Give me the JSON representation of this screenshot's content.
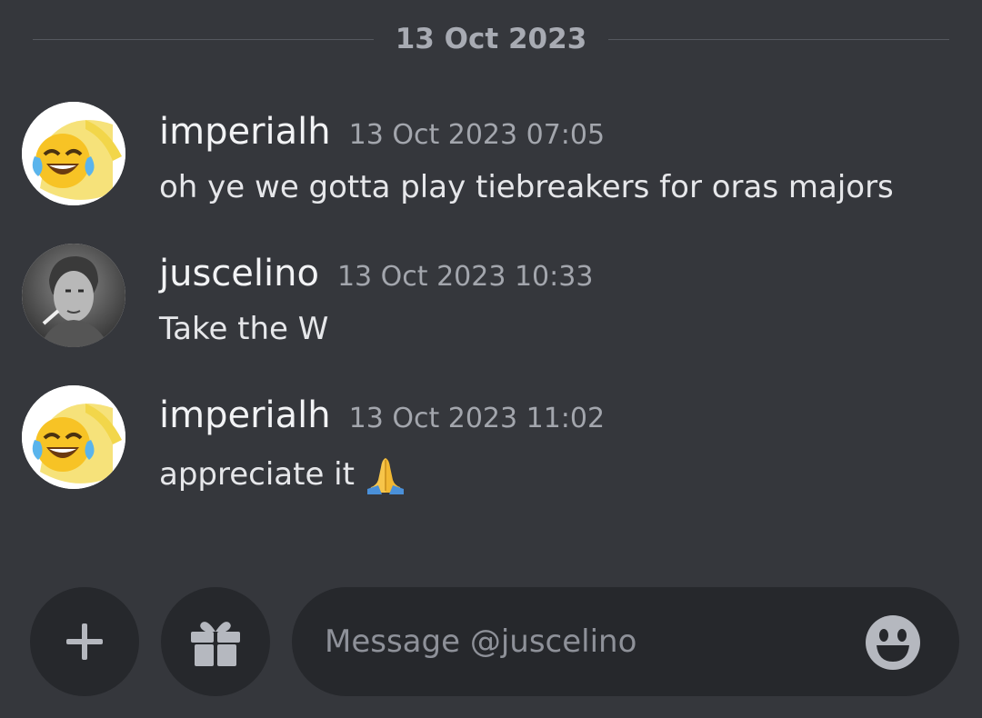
{
  "divider": {
    "date": "13 Oct 2023"
  },
  "messages": [
    {
      "username": "imperialh",
      "timestamp": "13 Oct 2023 07:05",
      "text": "oh ye we gotta play tiebreakers for oras majors",
      "avatar": "laughing-pikachu-avatar"
    },
    {
      "username": "juscelino",
      "timestamp": "13 Oct 2023 10:33",
      "text": "Take the W",
      "avatar": "bw-photo-smoking-man-avatar"
    },
    {
      "username": "imperialh",
      "timestamp": "13 Oct 2023 11:02",
      "text": "appreciate it",
      "emoji": "folded-hands-emoji",
      "avatar": "laughing-pikachu-avatar"
    }
  ],
  "composer": {
    "placeholder": "Message @juscelino",
    "value": "",
    "plus_icon": "plus-icon",
    "gift_icon": "gift-icon",
    "emoji_icon": "smiley-face-icon"
  },
  "colors": {
    "background": "#35373c",
    "composer_bg": "#26282c",
    "muted_text": "#a3a6ad"
  }
}
